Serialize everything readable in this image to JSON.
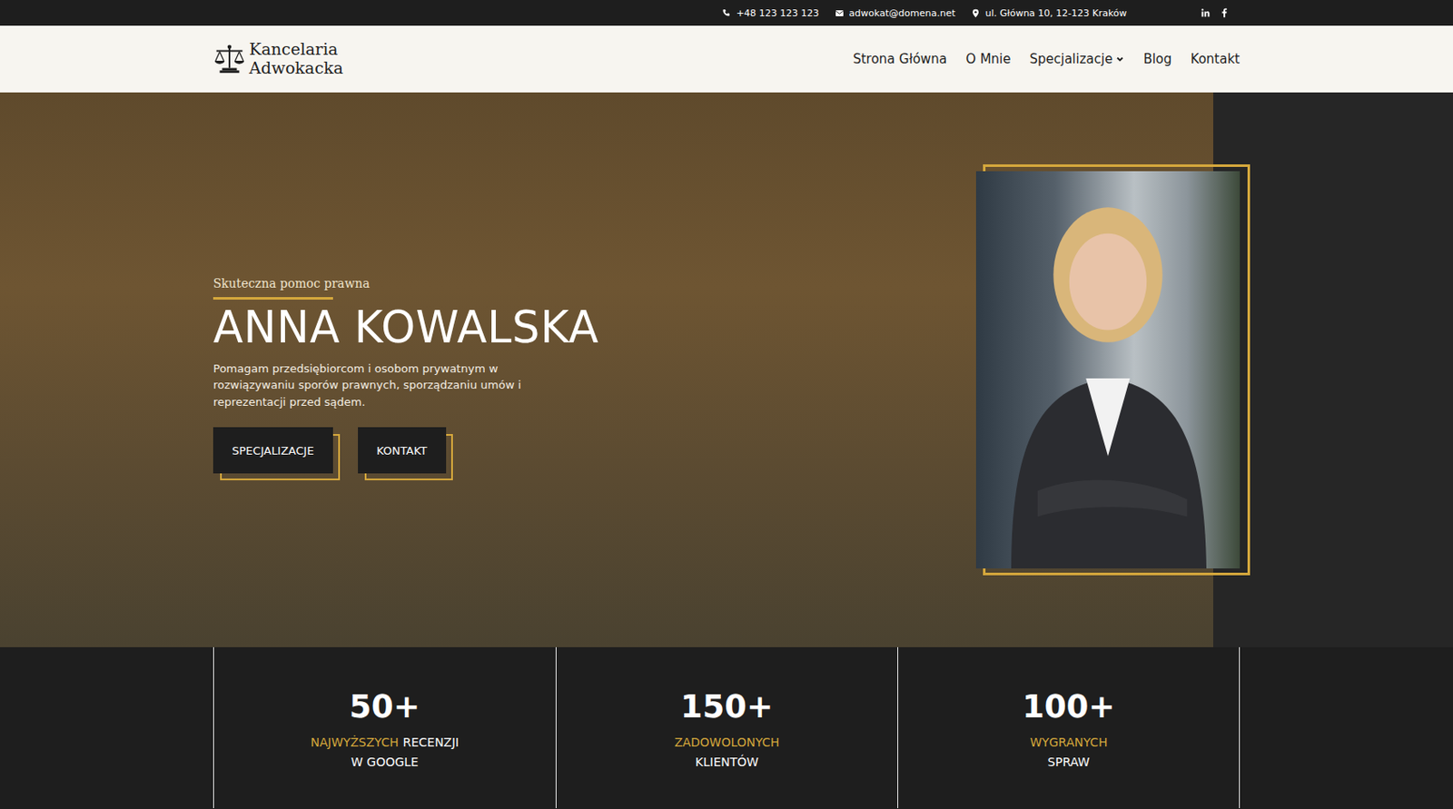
{
  "topbar": {
    "phone": "+48 123 123 123",
    "email": "adwokat@domena.net",
    "address": "ul. Główna 10, 12-123 Kraków",
    "socials": [
      "linkedin",
      "facebook"
    ]
  },
  "logo": {
    "lines": [
      "Kancelaria",
      "Adwokacka"
    ]
  },
  "nav": [
    {
      "label": "Strona Główna",
      "has_dropdown": false
    },
    {
      "label": "O Mnie",
      "has_dropdown": false
    },
    {
      "label": "Specjalizacje",
      "has_dropdown": true
    },
    {
      "label": "Blog",
      "has_dropdown": false
    },
    {
      "label": "Kontakt",
      "has_dropdown": false
    }
  ],
  "hero": {
    "eyebrow": "Skuteczna pomoc prawna",
    "title": "ANNA KOWALSKA",
    "description": "Pomagam przedsiębiorcom i osobom prywatnym w rozwiązywaniu sporów prawnych, sporządzaniu umów i reprezentacji przed sądem.",
    "buttons": [
      "SPECJALIZACJE",
      "KONTAKT"
    ]
  },
  "stats": [
    {
      "value": "50+",
      "lines": [
        [
          {
            "text": "NAJWYŻSZYCH",
            "accent": true
          },
          {
            "text": "RECENZJI",
            "accent": false
          }
        ],
        [
          {
            "text": "W GOOGLE",
            "accent": false
          }
        ]
      ]
    },
    {
      "value": "150+",
      "lines": [
        [
          {
            "text": "ZADOWOLONYCH",
            "accent": true
          }
        ],
        [
          {
            "text": "KLIENTÓW",
            "accent": false
          }
        ]
      ]
    },
    {
      "value": "100+",
      "lines": [
        [
          {
            "text": "WYGRANYCH",
            "accent": true
          }
        ],
        [
          {
            "text": "SPRAW",
            "accent": false
          }
        ]
      ]
    }
  ]
}
